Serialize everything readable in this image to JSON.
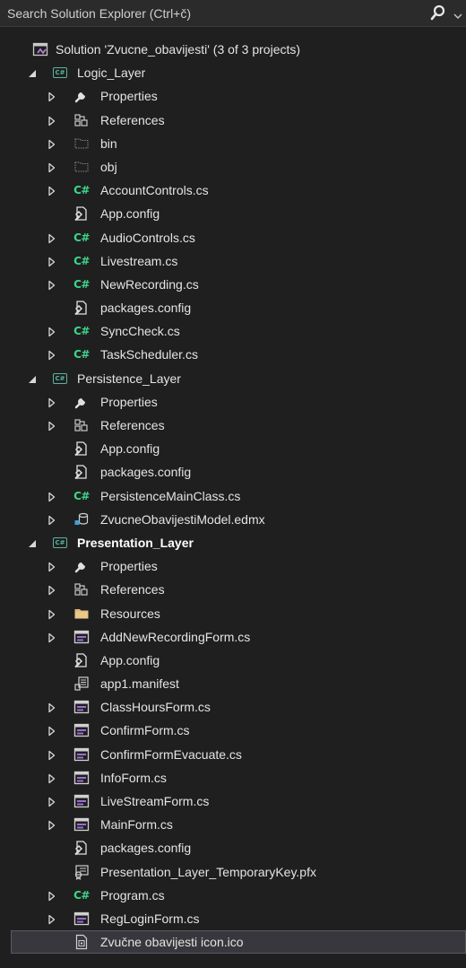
{
  "search": {
    "placeholder": "Search Solution Explorer (Ctrl+č)"
  },
  "colors": {
    "background": "#1f1f1f",
    "csharp_green": "#3dd68c",
    "selection": "#37373d"
  },
  "tree": [
    {
      "label": "Solution 'Zvucne_obavijesti' (3 of 3 projects)",
      "icon": "solution-icon",
      "level": 0,
      "expander": "none"
    },
    {
      "label": "Logic_Layer",
      "icon": "csharp-project-icon",
      "level": 1,
      "expander": "expanded"
    },
    {
      "label": "Properties",
      "icon": "wrench-icon",
      "level": 2,
      "expander": "collapsed"
    },
    {
      "label": "References",
      "icon": "references-icon",
      "level": 2,
      "expander": "collapsed"
    },
    {
      "label": "bin",
      "icon": "folder-dashed-icon",
      "level": 2,
      "expander": "collapsed"
    },
    {
      "label": "obj",
      "icon": "folder-dashed-icon",
      "level": 2,
      "expander": "collapsed"
    },
    {
      "label": "AccountControls.cs",
      "icon": "csharp-file-icon",
      "level": 2,
      "expander": "collapsed"
    },
    {
      "label": "App.config",
      "icon": "config-file-icon",
      "level": 2,
      "expander": "none"
    },
    {
      "label": "AudioControls.cs",
      "icon": "csharp-file-icon",
      "level": 2,
      "expander": "collapsed"
    },
    {
      "label": "Livestream.cs",
      "icon": "csharp-file-icon",
      "level": 2,
      "expander": "collapsed"
    },
    {
      "label": "NewRecording.cs",
      "icon": "csharp-file-icon",
      "level": 2,
      "expander": "collapsed"
    },
    {
      "label": "packages.config",
      "icon": "config-file-icon",
      "level": 2,
      "expander": "none"
    },
    {
      "label": "SyncCheck.cs",
      "icon": "csharp-file-icon",
      "level": 2,
      "expander": "collapsed"
    },
    {
      "label": "TaskScheduler.cs",
      "icon": "csharp-file-icon",
      "level": 2,
      "expander": "collapsed"
    },
    {
      "label": "Persistence_Layer",
      "icon": "csharp-project-icon",
      "level": 1,
      "expander": "expanded"
    },
    {
      "label": "Properties",
      "icon": "wrench-icon",
      "level": 2,
      "expander": "collapsed"
    },
    {
      "label": "References",
      "icon": "references-icon",
      "level": 2,
      "expander": "collapsed"
    },
    {
      "label": "App.config",
      "icon": "config-file-icon",
      "level": 2,
      "expander": "none"
    },
    {
      "label": "packages.config",
      "icon": "config-file-icon",
      "level": 2,
      "expander": "none"
    },
    {
      "label": "PersistenceMainClass.cs",
      "icon": "csharp-file-icon",
      "level": 2,
      "expander": "collapsed"
    },
    {
      "label": "ZvucneObavijestiModel.edmx",
      "icon": "edmx-icon",
      "level": 2,
      "expander": "collapsed"
    },
    {
      "label": "Presentation_Layer",
      "icon": "csharp-project-icon",
      "level": 1,
      "expander": "expanded",
      "bold": true
    },
    {
      "label": "Properties",
      "icon": "wrench-icon",
      "level": 2,
      "expander": "collapsed"
    },
    {
      "label": "References",
      "icon": "references-icon",
      "level": 2,
      "expander": "collapsed"
    },
    {
      "label": "Resources",
      "icon": "folder-icon",
      "level": 2,
      "expander": "collapsed"
    },
    {
      "label": "AddNewRecordingForm.cs",
      "icon": "form-icon",
      "level": 2,
      "expander": "collapsed"
    },
    {
      "label": "App.config",
      "icon": "config-file-icon",
      "level": 2,
      "expander": "none"
    },
    {
      "label": "app1.manifest",
      "icon": "manifest-icon",
      "level": 2,
      "expander": "none"
    },
    {
      "label": "ClassHoursForm.cs",
      "icon": "form-icon",
      "level": 2,
      "expander": "collapsed"
    },
    {
      "label": "ConfirmForm.cs",
      "icon": "form-icon",
      "level": 2,
      "expander": "collapsed"
    },
    {
      "label": "ConfirmFormEvacuate.cs",
      "icon": "form-icon",
      "level": 2,
      "expander": "collapsed"
    },
    {
      "label": "InfoForm.cs",
      "icon": "form-icon",
      "level": 2,
      "expander": "collapsed"
    },
    {
      "label": "LiveStreamForm.cs",
      "icon": "form-icon",
      "level": 2,
      "expander": "collapsed"
    },
    {
      "label": "MainForm.cs",
      "icon": "form-icon",
      "level": 2,
      "expander": "collapsed"
    },
    {
      "label": "packages.config",
      "icon": "config-file-icon",
      "level": 2,
      "expander": "none"
    },
    {
      "label": "Presentation_Layer_TemporaryKey.pfx",
      "icon": "certificate-icon",
      "level": 2,
      "expander": "none"
    },
    {
      "label": "Program.cs",
      "icon": "csharp-file-icon",
      "level": 2,
      "expander": "collapsed"
    },
    {
      "label": "RegLoginForm.cs",
      "icon": "form-icon",
      "level": 2,
      "expander": "collapsed"
    },
    {
      "label": "Zvučne obavijesti icon.ico",
      "icon": "ico-file-icon",
      "level": 2,
      "expander": "none",
      "selected": true
    }
  ]
}
